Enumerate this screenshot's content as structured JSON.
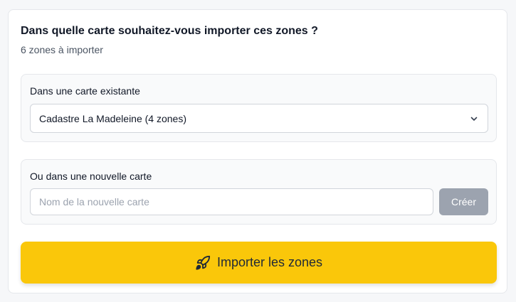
{
  "dialog": {
    "title": "Dans quelle carte souhaitez-vous importer ces zones ?",
    "subtitle": "6 zones à importer"
  },
  "existing_map": {
    "label": "Dans une carte existante",
    "selected": "Cadastre La Madeleine (4 zones)",
    "icon": "chevron-down-icon"
  },
  "new_map": {
    "label": "Ou dans une nouvelle carte",
    "input_value": "",
    "placeholder": "Nom de la nouvelle carte",
    "create_label": "Créer"
  },
  "import_button": {
    "label": "Importer les zones",
    "icon": "rocket-icon"
  },
  "colors": {
    "accent": "#fac70a",
    "disabled_button": "#9ca3af",
    "section_bg": "#f9fafb",
    "border": "#e5e7eb"
  }
}
